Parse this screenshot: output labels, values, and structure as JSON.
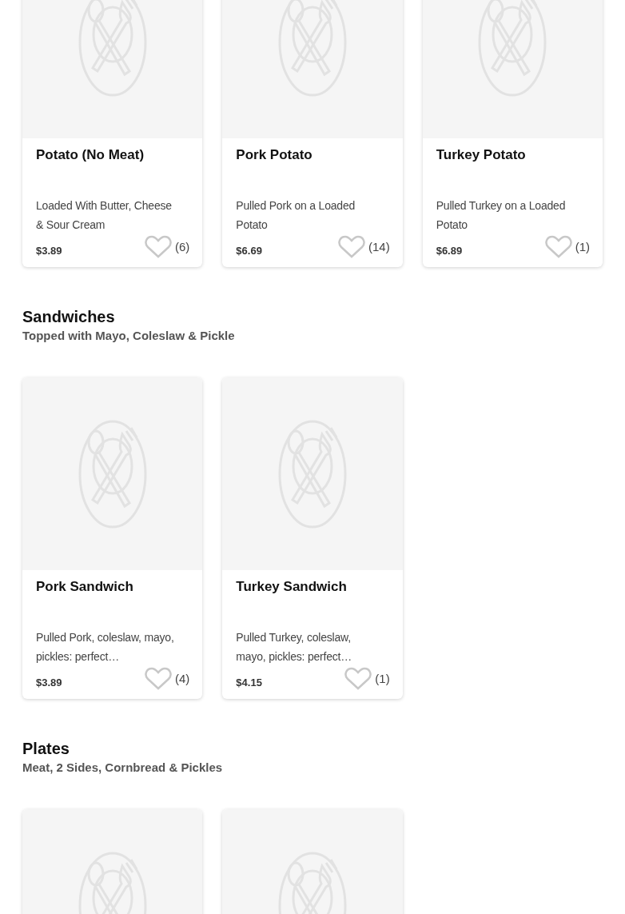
{
  "sections": [
    {
      "items": [
        {
          "kind": "product",
          "name": "Potato (No Meat)",
          "description": "Loaded With Butter, Cheese & Sour Cream",
          "price": "$3.89",
          "favorite": false,
          "count": "(6)"
        },
        {
          "kind": "product",
          "name": "Pork Potato",
          "description": "Pulled Pork on a Loaded Potato",
          "price": "$6.69",
          "favorite": false,
          "count": "(14)"
        },
        {
          "kind": "product",
          "name": "Turkey Potato",
          "description": "Pulled Turkey on a Loaded Potato",
          "price": "$6.89",
          "favorite": false,
          "count": "(1)"
        }
      ]
    },
    {
      "title": "Sandwiches",
      "subtitle": "Topped with Mayo, Coleslaw & Pickle",
      "items": [
        {
          "kind": "product",
          "name": "Pork Sandwich",
          "description": "Pulled Pork, coleslaw, mayo, pickles: perfect…",
          "price": "$3.89",
          "favorite": false,
          "count": "(4)"
        },
        {
          "kind": "product",
          "name": "Turkey Sandwich",
          "description": "Pulled Turkey, coleslaw, mayo, pickles: perfect…",
          "price": "$4.15",
          "favorite": false,
          "count": "(1)"
        }
      ]
    },
    {
      "title": "Plates",
      "subtitle": "Meat, 2 Sides, Cornbread & Pickles",
      "items": [
        {
          "kind": "image_only"
        },
        {
          "kind": "image_only"
        }
      ]
    }
  ]
}
